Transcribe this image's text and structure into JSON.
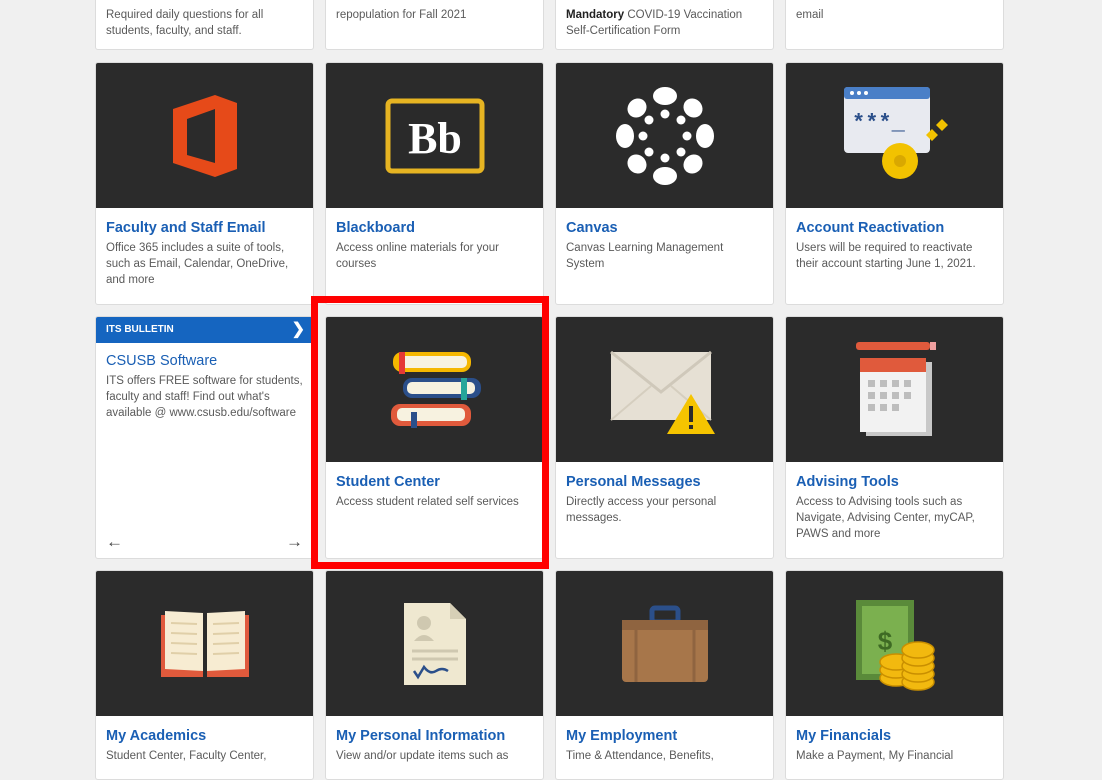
{
  "top_row": [
    {
      "desc": "Required daily questions for all students, faculty, and staff."
    },
    {
      "desc": "repopulation for Fall 2021"
    },
    {
      "desc_bold": "Mandatory",
      "desc": " COVID-19 Vaccination Self-Certification Form"
    },
    {
      "desc": "email"
    }
  ],
  "row2": [
    {
      "title": "Faculty and Staff Email",
      "desc": "Office 365 includes a suite of tools, such as Email, Calendar, OneDrive, and more",
      "icon": "office-365-icon"
    },
    {
      "title": "Blackboard",
      "desc": "Access online materials for your courses",
      "icon": "blackboard-icon",
      "logo_text": "Bb"
    },
    {
      "title": "Canvas",
      "desc": "Canvas Learning Management System",
      "icon": "canvas-icon"
    },
    {
      "title": "Account Reactivation",
      "desc": "Users will be required to reactivate their account starting June 1, 2021.",
      "icon": "password-key-icon",
      "pw_text": "***_"
    }
  ],
  "bulletin": {
    "label": "ITS BULLETIN",
    "chevron": "❯",
    "title": "CSUSB Software",
    "desc": "ITS offers FREE software for students, faculty and staff! Find out what's available @ www.csusb.edu/software",
    "prev_arrow": "←",
    "next_arrow": "→"
  },
  "row3": [
    {
      "title": "Student Center",
      "desc": "Access student related self services",
      "icon": "books-icon"
    },
    {
      "title": "Personal Messages",
      "desc": "Directly access your personal messages.",
      "icon": "envelope-warning-icon"
    },
    {
      "title": "Advising Tools",
      "desc": "Access to Advising tools such as Navigate, Advising Center, myCAP, PAWS and more",
      "icon": "calendar-icon"
    }
  ],
  "row4": [
    {
      "title": "My Academics",
      "desc": "Student Center, Faculty Center,",
      "icon": "open-book-icon"
    },
    {
      "title": "My Personal Information",
      "desc": "View and/or update items such as",
      "icon": "document-icon"
    },
    {
      "title": "My Employment",
      "desc": "Time & Attendance, Benefits,",
      "icon": "briefcase-icon"
    },
    {
      "title": "My Financials",
      "desc": "Make a Payment, My Financial",
      "icon": "money-icon"
    }
  ],
  "colors": {
    "link": "#1a5fb4",
    "tile_bg": "#2b2b2b",
    "bulletin": "#1565c0",
    "highlight": "#ff0000"
  }
}
